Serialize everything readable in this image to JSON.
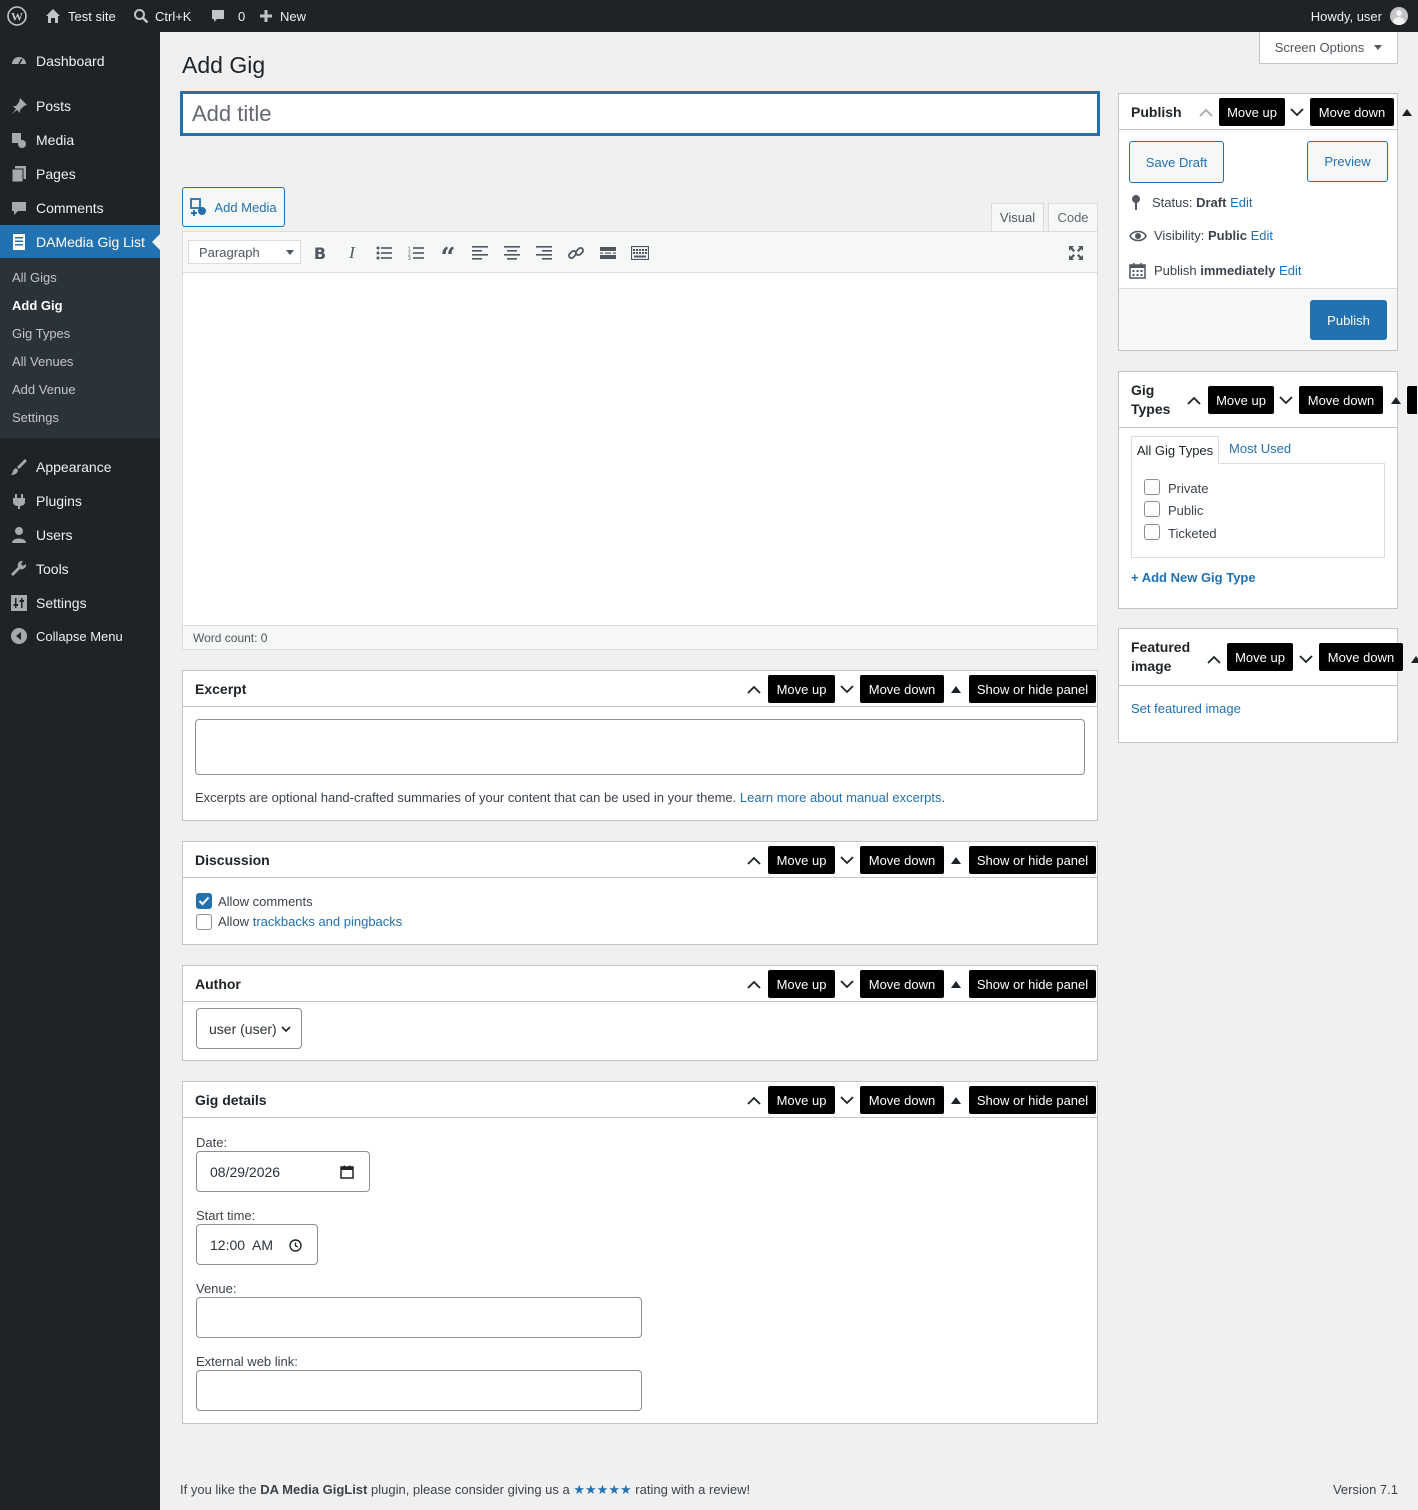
{
  "admin_bar": {
    "site_name": "Test site",
    "search_shortcut": "Ctrl+K",
    "comments_count": "0",
    "new_label": "New",
    "howdy": "Howdy, user"
  },
  "sidebar": {
    "items": [
      {
        "label": "Dashboard"
      },
      {
        "label": "Posts"
      },
      {
        "label": "Media"
      },
      {
        "label": "Pages"
      },
      {
        "label": "Comments"
      },
      {
        "label": "DAMedia Gig List"
      },
      {
        "label": "Appearance"
      },
      {
        "label": "Plugins"
      },
      {
        "label": "Users"
      },
      {
        "label": "Tools"
      },
      {
        "label": "Settings"
      },
      {
        "label": "Collapse Menu"
      }
    ],
    "submenu": [
      "All Gigs",
      "Add Gig",
      "Gig Types",
      "All Venues",
      "Add Venue",
      "Settings"
    ]
  },
  "screen_options": "Screen Options",
  "page_title": "Add Gig",
  "title_placeholder": "Add title",
  "editor": {
    "add_media": "Add Media",
    "tab_visual": "Visual",
    "tab_code": "Code",
    "format": "Paragraph",
    "word_count": "Word count: 0"
  },
  "controls": {
    "move_up": "Move up",
    "move_down": "Move down",
    "toggle": "Show or hide panel"
  },
  "excerpt": {
    "title": "Excerpt",
    "help": "Excerpts are optional hand-crafted summaries of your content that can be used in your theme.",
    "link": "Learn more about manual excerpts",
    "period": "."
  },
  "discussion": {
    "title": "Discussion",
    "allow_comments": "Allow comments",
    "allow_comments_checked": true,
    "allow_pings_prefix": "Allow",
    "allow_pings_link": "trackbacks and pingbacks",
    "allow_pings_checked": false
  },
  "author": {
    "title": "Author",
    "selected": "user (user)"
  },
  "gig_details": {
    "title": "Gig details",
    "date_label": "Date:",
    "date_value": "08/29/2026",
    "start_label": "Start time:",
    "start_value": "12:00  AM",
    "venue_label": "Venue:",
    "venue_value": "",
    "link_label": "External web link:",
    "link_value": ""
  },
  "publish": {
    "title": "Publish",
    "save_draft": "Save Draft",
    "preview": "Preview",
    "status_label": "Status:",
    "status_value": "Draft",
    "visibility_label": "Visibility:",
    "visibility_value": "Public",
    "publish_label": "Publish",
    "publish_value": "immediately",
    "edit": "Edit",
    "publish_button": "Publish"
  },
  "gig_types": {
    "title_line1": "Gig",
    "title_line2": "Types",
    "tab_all": "All Gig Types",
    "tab_most_used": "Most Used",
    "items": [
      "Private",
      "Public",
      "Ticketed"
    ],
    "add_new": "+ Add New Gig Type"
  },
  "featured_image": {
    "title_line1": "Featured",
    "title_line2": "image",
    "set_link": "Set featured image"
  },
  "footer": {
    "left_prefix": "If you like the",
    "plugin_name": "DA Media GigList",
    "left_middle": "plugin, please consider giving us a",
    "stars": "★★★★★",
    "left_suffix": "rating with a review!",
    "version": "Version 7.1"
  },
  "colors": {
    "accent": "#2271b1",
    "admin_dark": "#1d2327",
    "background": "#f0f0f1"
  }
}
